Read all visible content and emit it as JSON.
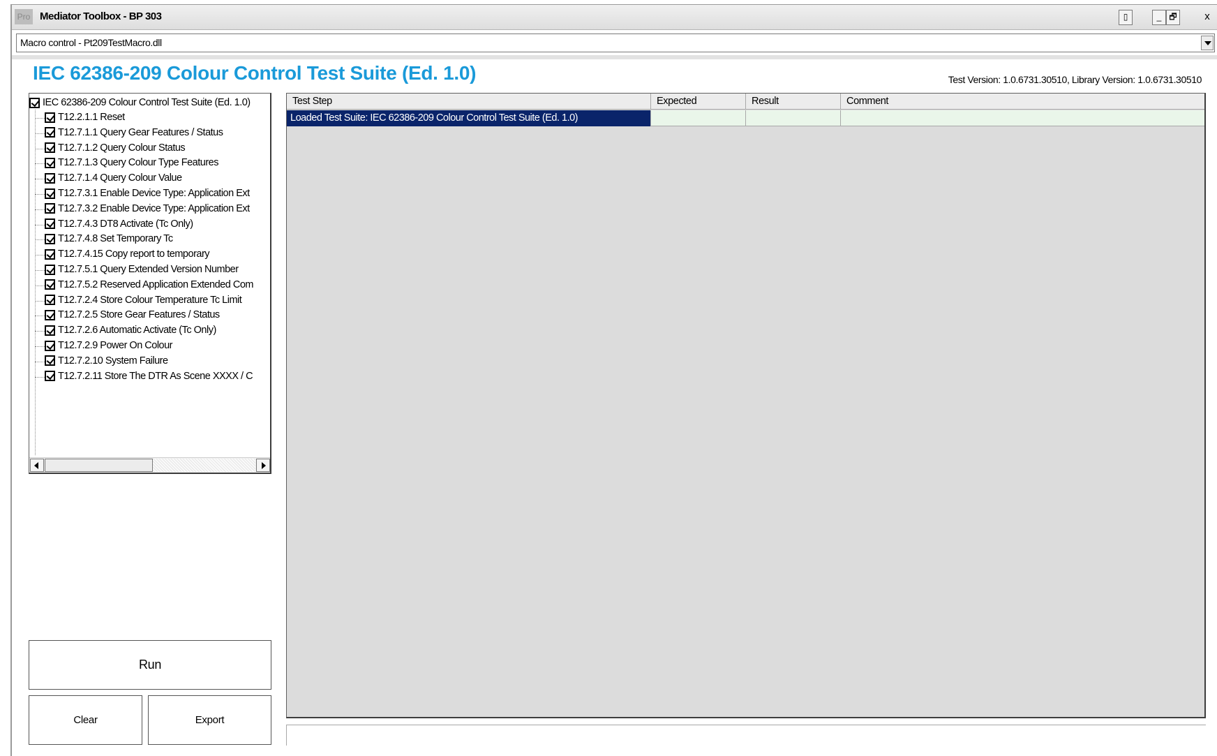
{
  "window": {
    "icon_text": "Pro",
    "title": "Mediator Toolbox - BP 303",
    "controls": {
      "help": "▯",
      "minimize": "_",
      "restore": "🗗",
      "close": "x"
    }
  },
  "macro_control": {
    "value": "Macro control - Pt209TestMacro.dll"
  },
  "header": {
    "suite_title": "IEC 62386-209 Colour Control Test Suite (Ed. 1.0)",
    "version_info": "Test Version: 1.0.6731.30510, Library Version: 1.0.6731.30510"
  },
  "tree": {
    "root": {
      "label": "IEC 62386-209 Colour Control Test Suite (Ed. 1.0)",
      "checked": true
    },
    "items": [
      {
        "label": "T12.2.1.1 Reset",
        "checked": true
      },
      {
        "label": "T12.7.1.1 Query Gear Features / Status",
        "checked": true
      },
      {
        "label": "T12.7.1.2 Query Colour Status",
        "checked": true
      },
      {
        "label": "T12.7.1.3 Query Colour Type Features",
        "checked": true
      },
      {
        "label": "T12.7.1.4 Query Colour Value",
        "checked": true
      },
      {
        "label": "T12.7.3.1 Enable Device Type: Application Ext",
        "checked": true
      },
      {
        "label": "T12.7.3.2 Enable Device Type: Application Ext",
        "checked": true
      },
      {
        "label": "T12.7.4.3 DT8 Activate (Tc Only)",
        "checked": true
      },
      {
        "label": "T12.7.4.8 Set Temporary Tc",
        "checked": true
      },
      {
        "label": "T12.7.4.15 Copy report to temporary",
        "checked": true
      },
      {
        "label": "T12.7.5.1 Query Extended Version Number",
        "checked": true
      },
      {
        "label": "T12.7.5.2 Reserved Application Extended Com",
        "checked": true
      },
      {
        "label": "T12.7.2.4 Store Colour Temperature Tc Limit",
        "checked": true
      },
      {
        "label": "T12.7.2.5 Store Gear Features / Status",
        "checked": true
      },
      {
        "label": "T12.7.2.6 Automatic Activate (Tc Only)",
        "checked": true
      },
      {
        "label": "T12.7.2.9 Power On Colour",
        "checked": true
      },
      {
        "label": "T12.7.2.10 System Failure",
        "checked": true
      },
      {
        "label": "T12.7.2.11 Store The DTR As Scene XXXX / C",
        "checked": true
      }
    ]
  },
  "grid": {
    "columns": [
      "Test Step",
      "Expected",
      "Result",
      "Comment"
    ],
    "rows": [
      {
        "test_step": "Loaded Test Suite: IEC 62386-209 Colour Control Test Suite (Ed. 1.0)",
        "expected": "",
        "result": "",
        "comment": ""
      }
    ]
  },
  "buttons": {
    "run": "Run",
    "clear": "Clear",
    "export": "Export"
  },
  "colors": {
    "title_blue": "#1a9ad9",
    "selection": "#0a246a",
    "row_bg": "#eaf6ea",
    "grid_bg": "#dcdcdc"
  }
}
